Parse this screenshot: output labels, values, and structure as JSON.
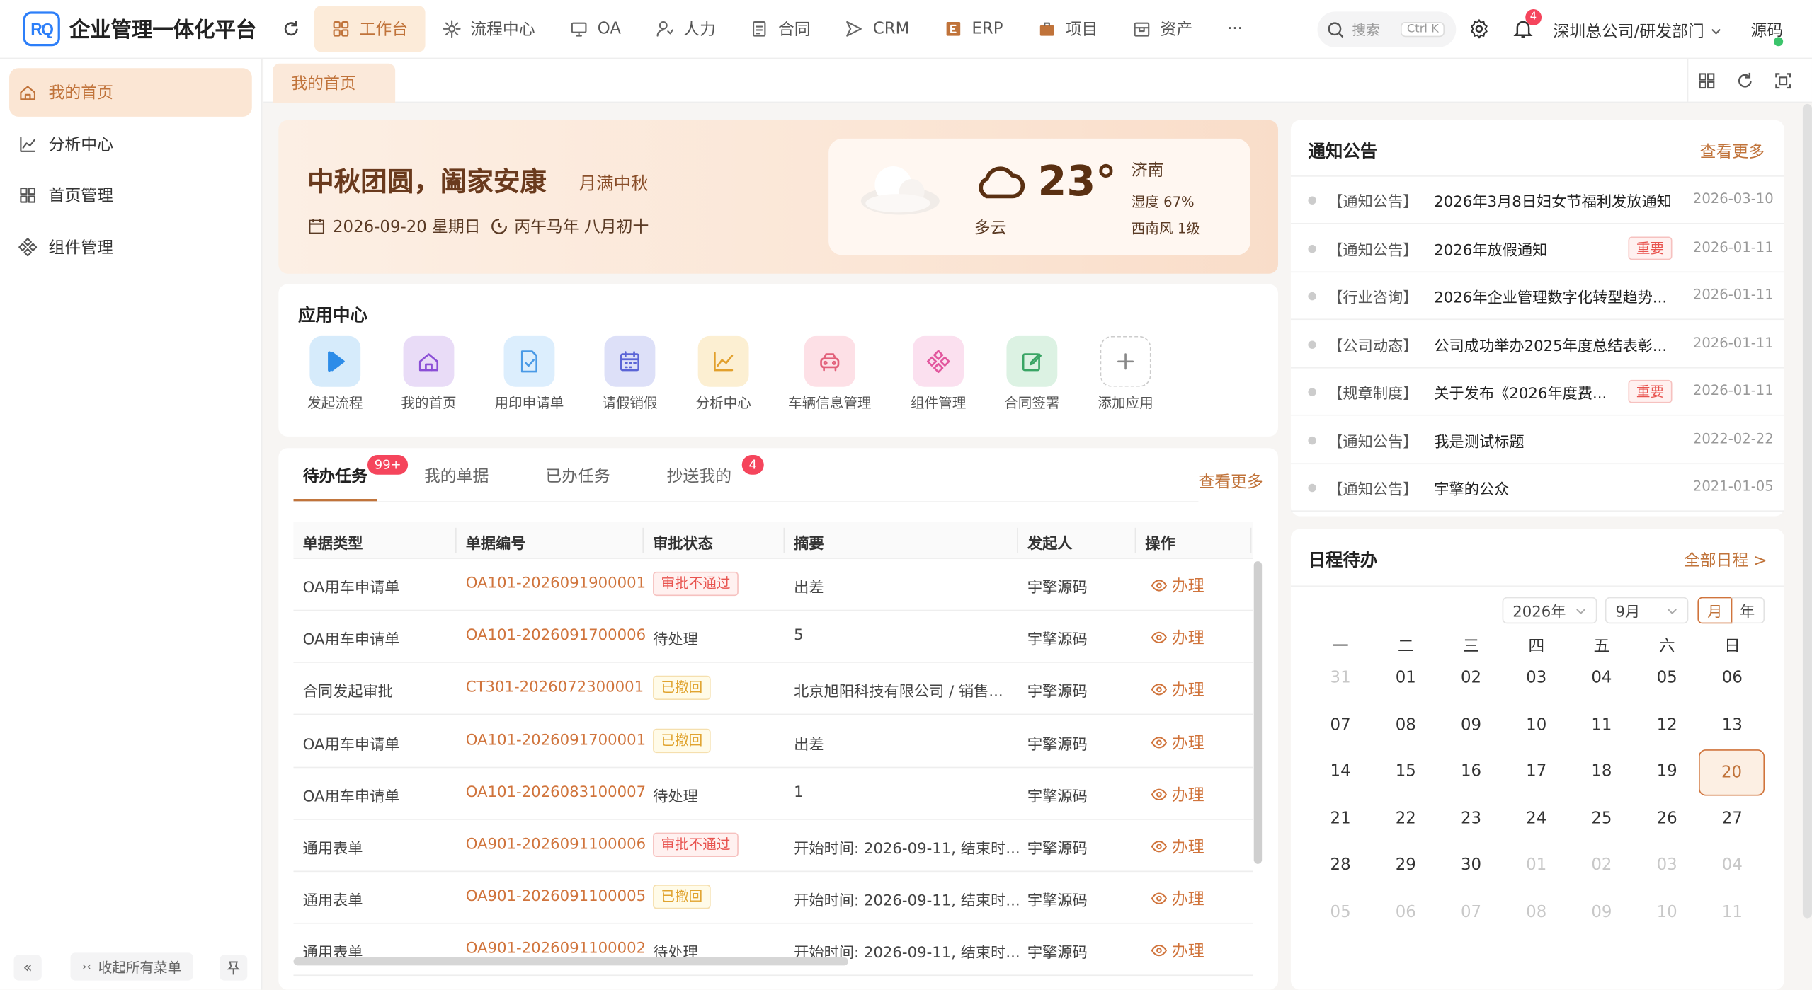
{
  "header": {
    "logo_text": "RQ",
    "title": "企业管理一体化平台",
    "nav": [
      {
        "label": "工作台",
        "icon": "grid-icon",
        "active": true
      },
      {
        "label": "流程中心",
        "icon": "flow-icon"
      },
      {
        "label": "OA",
        "icon": "monitor-icon"
      },
      {
        "label": "人力",
        "icon": "user-icon"
      },
      {
        "label": "合同",
        "icon": "document-icon"
      },
      {
        "label": "CRM",
        "icon": "send-icon"
      },
      {
        "label": "ERP",
        "icon": "erp-icon"
      },
      {
        "label": "项目",
        "icon": "briefcase-icon"
      },
      {
        "label": "资产",
        "icon": "box-icon"
      }
    ],
    "more": "···",
    "search_placeholder": "搜索",
    "search_shortcut": "Ctrl K",
    "notification_count": "4",
    "org": "深圳总公司/研发部门",
    "user": "源码"
  },
  "sidebar": {
    "items": [
      {
        "label": "我的首页",
        "icon": "home-icon",
        "active": true
      },
      {
        "label": "分析中心",
        "icon": "chart-icon"
      },
      {
        "label": "首页管理",
        "icon": "layout-icon"
      },
      {
        "label": "组件管理",
        "icon": "component-icon"
      }
    ],
    "collapse_all": "收起所有菜单",
    "fold": "«"
  },
  "tabs": {
    "current": "我的首页"
  },
  "banner": {
    "title": "中秋团圆，阖家安康",
    "subtitle": "月满中秋",
    "date": "2026-09-20 星期日",
    "lunar": "丙午马年 八月初十"
  },
  "weather": {
    "temp": "23°",
    "condition": "多云",
    "city": "济南",
    "humidity": "湿度 67%",
    "wind": "西南风 1级"
  },
  "app_center": {
    "title": "应用中心",
    "apps": [
      {
        "label": "发起流程",
        "icon": "play-icon",
        "bg": "#d6ebfb",
        "fg": "#2d8ce8"
      },
      {
        "label": "我的首页",
        "icon": "home-icon",
        "bg": "#e9dcf7",
        "fg": "#8b4fd6"
      },
      {
        "label": "用印申请单",
        "icon": "file-check-icon",
        "bg": "#dceefd",
        "fg": "#4a9ae6"
      },
      {
        "label": "请假销假",
        "icon": "calendar-icon",
        "bg": "#dde0f8",
        "fg": "#5a64d6"
      },
      {
        "label": "分析中心",
        "icon": "chart-icon",
        "bg": "#fcefd2",
        "fg": "#e2a02c"
      },
      {
        "label": "车辆信息管理",
        "icon": "car-icon",
        "bg": "#fde0e6",
        "fg": "#e2607a"
      },
      {
        "label": "组件管理",
        "icon": "component-icon",
        "bg": "#fbe0ef",
        "fg": "#e2579e"
      },
      {
        "label": "合同签署",
        "icon": "edit-icon",
        "bg": "#dcf2e3",
        "fg": "#3aa565"
      },
      {
        "label": "添加应用",
        "icon": "plus-icon",
        "bg": "#ffffff",
        "fg": "#888888"
      }
    ]
  },
  "tasks": {
    "tabs": [
      {
        "label": "待办任务",
        "badge": "99+",
        "active": true
      },
      {
        "label": "我的单据"
      },
      {
        "label": "已办任务"
      },
      {
        "label": "抄送我的",
        "badge": "4"
      }
    ],
    "more": "查看更多",
    "columns": [
      "单据类型",
      "单据编号",
      "审批状态",
      "摘要",
      "发起人",
      "操作"
    ],
    "rows": [
      {
        "type": "OA用车申请单",
        "no": "OA101-2026091900001",
        "status": "审批不通过",
        "status_style": "red",
        "summary": "出差",
        "initiator": "宇擎源码",
        "action": "办理"
      },
      {
        "type": "OA用车申请单",
        "no": "OA101-2026091700006",
        "status": "待处理",
        "status_style": "plain",
        "summary": "5",
        "initiator": "宇擎源码",
        "action": "办理"
      },
      {
        "type": "合同发起审批",
        "no": "CT301-2026072300001",
        "status": "已撤回",
        "status_style": "yellow",
        "summary": "北京旭阳科技有限公司 / 销售...",
        "initiator": "宇擎源码",
        "action": "办理"
      },
      {
        "type": "OA用车申请单",
        "no": "OA101-2026091700001",
        "status": "已撤回",
        "status_style": "yellow",
        "summary": "出差",
        "initiator": "宇擎源码",
        "action": "办理"
      },
      {
        "type": "OA用车申请单",
        "no": "OA101-2026083100007",
        "status": "待处理",
        "status_style": "plain",
        "summary": "1",
        "initiator": "宇擎源码",
        "action": "办理"
      },
      {
        "type": "通用表单",
        "no": "OA901-2026091100006",
        "status": "审批不通过",
        "status_style": "red",
        "summary": "开始时间: 2026-09-11, 结束时...",
        "initiator": "宇擎源码",
        "action": "办理"
      },
      {
        "type": "通用表单",
        "no": "OA901-2026091100005",
        "status": "已撤回",
        "status_style": "yellow",
        "summary": "开始时间: 2026-09-11, 结束时...",
        "initiator": "宇擎源码",
        "action": "办理"
      },
      {
        "type": "通用表单",
        "no": "OA901-2026091100002",
        "status": "待处理",
        "status_style": "plain",
        "summary": "开始时间: 2026-09-11, 结束时...",
        "initiator": "宇擎源码",
        "action": "办理"
      }
    ]
  },
  "notices": {
    "title": "通知公告",
    "more": "查看更多",
    "items": [
      {
        "category": "【通知公告】",
        "title": "2026年3月8日妇女节福利发放通知",
        "tag": "",
        "date": "2026-03-10"
      },
      {
        "category": "【通知公告】",
        "title": "2026年放假通知",
        "tag": "重要",
        "date": "2026-01-11"
      },
      {
        "category": "【行业咨询】",
        "title": "2026年企业管理数字化转型趋势...",
        "tag": "",
        "date": "2026-01-11"
      },
      {
        "category": "【公司动态】",
        "title": "公司成功举办2025年度总结表彰...",
        "tag": "",
        "date": "2026-01-11"
      },
      {
        "category": "【规章制度】",
        "title": "关于发布《2026年度费...",
        "tag": "重要",
        "date": "2026-01-11"
      },
      {
        "category": "【通知公告】",
        "title": "我是测试标题",
        "tag": "",
        "date": "2022-02-22"
      },
      {
        "category": "【通知公告】",
        "title": "宇擎的公众",
        "tag": "",
        "date": "2021-01-05"
      }
    ]
  },
  "schedule": {
    "title": "日程待办",
    "all": "全部日程 >",
    "year": "2026年",
    "month": "9月",
    "mode_month": "月",
    "mode_year": "年",
    "weekdays": [
      "一",
      "二",
      "三",
      "四",
      "五",
      "六",
      "日"
    ],
    "weeks": [
      [
        "31",
        "01",
        "02",
        "03",
        "04",
        "05",
        "06"
      ],
      [
        "07",
        "08",
        "09",
        "10",
        "11",
        "12",
        "13"
      ],
      [
        "14",
        "15",
        "16",
        "17",
        "18",
        "19",
        "20"
      ],
      [
        "21",
        "22",
        "23",
        "24",
        "25",
        "26",
        "27"
      ],
      [
        "28",
        "29",
        "30",
        "01",
        "02",
        "03",
        "04"
      ],
      [
        "05",
        "06",
        "07",
        "08",
        "09",
        "10",
        "11"
      ]
    ],
    "today": "20"
  }
}
